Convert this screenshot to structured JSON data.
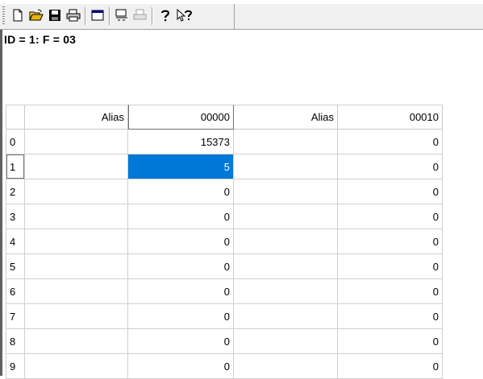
{
  "window": {
    "caption": "ID = 1: F = 03"
  },
  "toolbar": {
    "buttons": [
      {
        "name": "new-icon"
      },
      {
        "name": "open-icon"
      },
      {
        "name": "save-icon"
      },
      {
        "name": "print-icon"
      },
      {
        "name": "window-icon"
      },
      {
        "name": "connect-icon"
      },
      {
        "name": "disconnect-icon"
      },
      {
        "name": "help-icon"
      },
      {
        "name": "context-help-icon"
      }
    ]
  },
  "grid": {
    "columns": [
      "Alias",
      "00000",
      "Alias",
      "00010"
    ],
    "rows": [
      {
        "index": "0",
        "alias1": "",
        "v1": "15373",
        "alias2": "",
        "v2": "0"
      },
      {
        "index": "1",
        "alias1": "",
        "v1": "5",
        "alias2": "",
        "v2": "0"
      },
      {
        "index": "2",
        "alias1": "",
        "v1": "0",
        "alias2": "",
        "v2": "0"
      },
      {
        "index": "3",
        "alias1": "",
        "v1": "0",
        "alias2": "",
        "v2": "0"
      },
      {
        "index": "4",
        "alias1": "",
        "v1": "0",
        "alias2": "",
        "v2": "0"
      },
      {
        "index": "5",
        "alias1": "",
        "v1": "0",
        "alias2": "",
        "v2": "0"
      },
      {
        "index": "6",
        "alias1": "",
        "v1": "0",
        "alias2": "",
        "v2": "0"
      },
      {
        "index": "7",
        "alias1": "",
        "v1": "0",
        "alias2": "",
        "v2": "0"
      },
      {
        "index": "8",
        "alias1": "",
        "v1": "0",
        "alias2": "",
        "v2": "0"
      },
      {
        "index": "9",
        "alias1": "",
        "v1": "0",
        "alias2": "",
        "v2": "0"
      }
    ],
    "selected_row": 1,
    "selection_color": "#0078d7"
  }
}
